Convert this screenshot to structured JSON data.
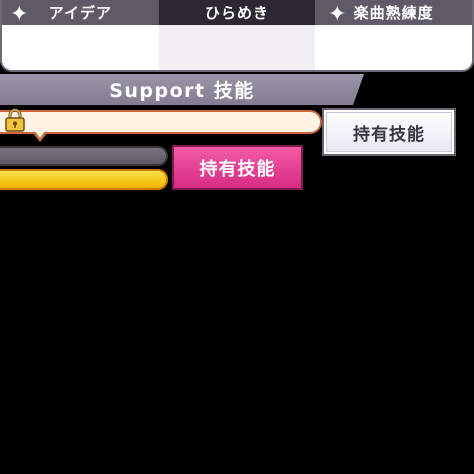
{
  "tabs": [
    {
      "label": "アイデア",
      "active": false
    },
    {
      "label": "ひらめき",
      "active": true
    },
    {
      "label": "楽曲熟練度",
      "active": false
    }
  ],
  "support": {
    "title": "Support 技能"
  },
  "buttons": {
    "owned_skill_primary": "持有技能",
    "owned_skill_secondary": "持有技能"
  },
  "icons": {
    "lock": "lock-icon",
    "sparkle": "sparkle-icon"
  },
  "colors": {
    "tab_header": "#5f5a68",
    "tab_active": "#2c2833",
    "banner": "#8d879b",
    "pink_button": "#e23d92",
    "gold_bar": "#f8c81c",
    "bubble_fill": "#fff3e6",
    "bubble_border": "#c96a3b"
  }
}
